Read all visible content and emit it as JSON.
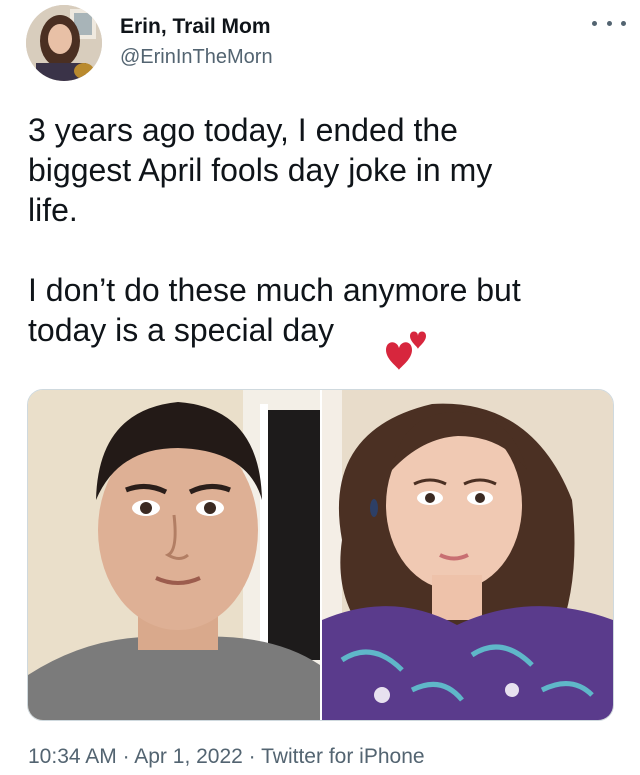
{
  "author": {
    "display_name": "Erin, Trail Mom",
    "handle": "@ErinInTheMorn",
    "avatar_icon": "profile-photo"
  },
  "more_options_icon": "ellipsis-icon",
  "tweet": {
    "text": "3 years ago today, I ended the\nbiggest April fools day joke in my\nlife.\n\nI don’t do these much anymore but\ntoday is a special day",
    "emoji": "heart-icon"
  },
  "media": {
    "photos": [
      {
        "subject": "selfie-before"
      },
      {
        "subject": "selfie-after"
      }
    ]
  },
  "meta": {
    "time": "10:34 AM",
    "separator": " · ",
    "date": "Apr 1, 2022",
    "source": "Twitter for iPhone"
  },
  "colors": {
    "text_primary": "#0f1419",
    "text_secondary": "#536471",
    "heart": "#d7263d",
    "border": "#cfd9de"
  }
}
